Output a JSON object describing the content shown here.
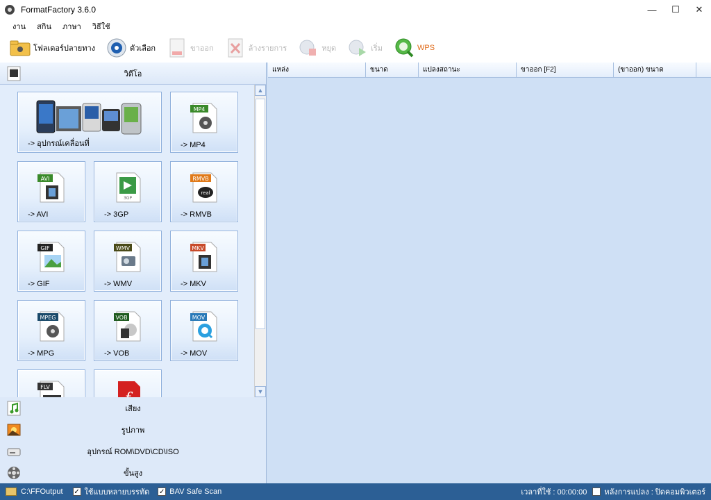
{
  "window": {
    "title": "FormatFactory 3.6.0",
    "minimize": "—",
    "maximize": "☐",
    "close": "✕"
  },
  "menu": [
    "งาน",
    "สกิน",
    "ภาษา",
    "วิธีใช้"
  ],
  "toolbar": {
    "output_folder": "โฟลเดอร์ปลายทาง",
    "options": "ตัวเลือก",
    "remove": "ขาออก",
    "clear_list": "ล้างรายการ",
    "stop": "หยุด",
    "start": "เริ่ม",
    "wps": "WPS"
  },
  "left": {
    "video_header": "วิดีโอ",
    "tiles": [
      {
        "label": "-> อุปกรณ์เคลื่อนที่",
        "badge": ""
      },
      {
        "label": "-> MP4",
        "badge": "MP4"
      },
      {
        "label": "-> AVI",
        "badge": "AVI"
      },
      {
        "label": "-> 3GP",
        "badge": "3GP"
      },
      {
        "label": "-> RMVB",
        "badge": "RMVB"
      },
      {
        "label": "-> GIF",
        "badge": "GIF"
      },
      {
        "label": "-> WMV",
        "badge": "WMV"
      },
      {
        "label": "-> MKV",
        "badge": "MKV"
      },
      {
        "label": "-> MPG",
        "badge": "MPEG"
      },
      {
        "label": "-> VOB",
        "badge": "VOB"
      },
      {
        "label": "-> MOV",
        "badge": "MOV"
      },
      {
        "label": "",
        "badge": "FLV"
      },
      {
        "label": "",
        "badge": ""
      }
    ],
    "categories": {
      "audio": "เสียง",
      "picture": "รูปภาพ",
      "rom": "อุปกรณ์ ROM\\DVD\\CD\\ISO",
      "advanced": "ขั้นสูง"
    }
  },
  "list": {
    "columns": [
      "แหล่ง",
      "ขนาด",
      "แปลงสถานะ",
      "ขาออก [F2]",
      "(ขาออก) ขนาด"
    ]
  },
  "status": {
    "output_path": "C:\\FFOutput",
    "multithread": "ใช้แบบหลายบรรทัด",
    "bav": "BAV Safe Scan",
    "elapsed": "เวลาที่ใช้ : 00:00:00",
    "after": "หลังการแปลง : ปิดคอมพิวเตอร์"
  },
  "colors": {
    "accent": "#2c5f95",
    "panel": "#dde9f9",
    "list_bg": "#cfe0f5"
  }
}
